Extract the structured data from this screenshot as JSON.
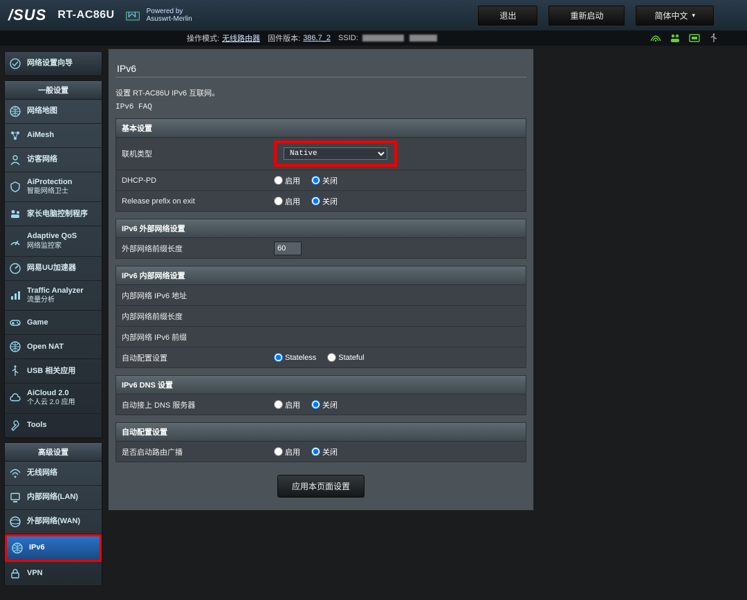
{
  "top": {
    "brand": "/SUS",
    "model": "RT-AC86U",
    "powered_line1": "Powered by",
    "powered_line2": "Asuswrt-Merlin",
    "logout": "退出",
    "reboot": "重新启动",
    "language": "简体中文"
  },
  "status": {
    "opmode_label": "操作模式:",
    "opmode_link": "无线路由器",
    "fw_label": "固件版本:",
    "fw_link": "386.7_2",
    "ssid_label": "SSID:"
  },
  "sidebar": {
    "wizard": "网络设置向导",
    "general_header": "一般设置",
    "general": [
      {
        "label": "网络地图",
        "icon": "globe-icon"
      },
      {
        "label": "AiMesh",
        "icon": "mesh-icon"
      },
      {
        "label": "访客网络",
        "icon": "guest-icon"
      },
      {
        "label": "AiProtection",
        "sub": "智能网络卫士",
        "icon": "shield-icon"
      },
      {
        "label": "家长电脑控制程序",
        "icon": "parental-icon"
      },
      {
        "label": "Adaptive QoS",
        "sub": "网络监控家",
        "icon": "gauge-icon"
      },
      {
        "label": "网易UU加速器",
        "icon": "speed-icon"
      },
      {
        "label": "Traffic Analyzer",
        "sub": "流量分析",
        "icon": "chart-icon"
      },
      {
        "label": "Game",
        "icon": "gamepad-icon"
      },
      {
        "label": "Open NAT",
        "icon": "globe2-icon"
      },
      {
        "label": "USB 相关应用",
        "icon": "usb-icon"
      },
      {
        "label": "AiCloud 2.0",
        "sub": "个人云 2.0 应用",
        "icon": "cloud-icon"
      },
      {
        "label": "Tools",
        "icon": "wrench-icon"
      }
    ],
    "advanced_header": "高级设置",
    "advanced": [
      {
        "label": "无线网络",
        "icon": "wifi-icon"
      },
      {
        "label": "内部网络(LAN)",
        "icon": "lan-icon"
      },
      {
        "label": "外部网络(WAN)",
        "icon": "wan-icon"
      },
      {
        "label": "IPv6",
        "icon": "globe3-icon",
        "active": true,
        "highlighted": true
      },
      {
        "label": "VPN",
        "icon": "vpn-icon"
      }
    ]
  },
  "page": {
    "title": "IPv6",
    "intro": "设置 RT-AC86U IPv6 互联网。",
    "faq": "IPv6 FAQ",
    "basic": {
      "header": "基本设置",
      "conn_type_label": "联机类型",
      "conn_type_value": "Native",
      "dhcp_pd_label": "DHCP-PD",
      "release_prefix_label": "Release prefix on exit"
    },
    "wan": {
      "header": "IPv6 外部网络设置",
      "prefix_len_label": "外部网络前缀长度",
      "prefix_len_value": "60"
    },
    "lan": {
      "header": "IPv6 内部网络设置",
      "addr_label": "内部网络 IPv6 地址",
      "prefix_len_label": "内部网络前缀长度",
      "prefix_label": "内部网络 IPv6 前缀",
      "autoconf_label": "自动配置设置",
      "stateless": "Stateless",
      "stateful": "Stateful"
    },
    "dns": {
      "header": "IPv6 DNS 设置",
      "auto_label": "自动接上 DNS 服务器"
    },
    "autoconf": {
      "header": "自动配置设置",
      "ra_label": "是否启动路由广播"
    },
    "enable": "启用",
    "disable": "关闭",
    "apply": "应用本页面设置"
  }
}
